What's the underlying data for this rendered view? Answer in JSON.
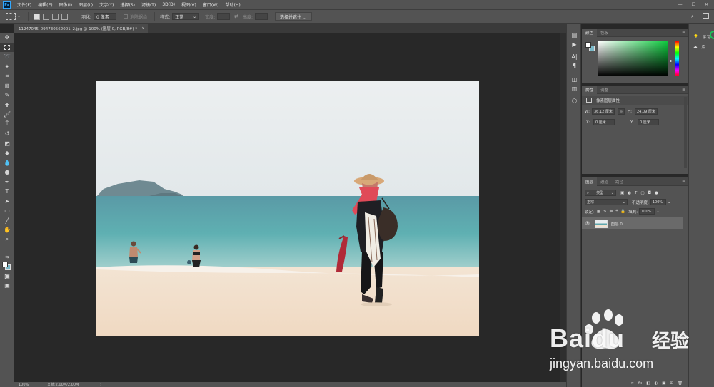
{
  "app": {
    "logo_text": "Ps"
  },
  "menubar": {
    "items": [
      "文件(F)",
      "编辑(E)",
      "图像(I)",
      "图层(L)",
      "文字(Y)",
      "选择(S)",
      "滤镜(T)",
      "3D(D)",
      "视图(V)",
      "窗口(W)",
      "帮助(H)"
    ],
    "window_controls": [
      "—",
      "☐",
      "✕"
    ]
  },
  "options": {
    "feather_label": "羽化:",
    "feather_value": "0 像素",
    "antialias_label": "消除锯齿",
    "style_label": "样式:",
    "style_value": "正常",
    "width_label": "宽度:",
    "height_label": "高度:",
    "select_mask_label": "选择并遮住 ..."
  },
  "document": {
    "tab_title": "11247045_094730562001_2.jpg @ 100% (图层 0, RGB/8#) *",
    "tab_close": "×",
    "zoom": "100%",
    "doc_info": "文档:2.00M/2.00M"
  },
  "color_panel": {
    "tabs": [
      "颜色",
      "色板"
    ],
    "accent_green": "#0bc83c"
  },
  "properties_panel": {
    "tabs": [
      "属性",
      "调整"
    ],
    "section_title": "像素图层属性",
    "w_label": "W:",
    "w_value": "36.12 厘米",
    "h_label": "H:",
    "h_value": "24.09 厘米",
    "x_label": "X:",
    "x_value": "0 厘米",
    "y_label": "Y:",
    "y_value": "0 厘米",
    "link_icon": "∞"
  },
  "layers_panel": {
    "tabs": [
      "图层",
      "通道",
      "路径"
    ],
    "filter_label": "类型",
    "blend_mode": "正常",
    "opacity_label": "不透明度:",
    "opacity_value": "100%",
    "lock_label": "锁定:",
    "fill_label": "填充:",
    "fill_value": "100%",
    "layer_name": "图层 0",
    "footer_icons": [
      "∞",
      "fx",
      "◧",
      "◐",
      "▣",
      "⊞",
      "🗑"
    ]
  },
  "right_strip": {
    "learn_label": "学习",
    "library_label": "库"
  },
  "watermark": {
    "brand": "Baidu",
    "brand_cn": "经验",
    "url": "jingyan.baidu.com"
  }
}
